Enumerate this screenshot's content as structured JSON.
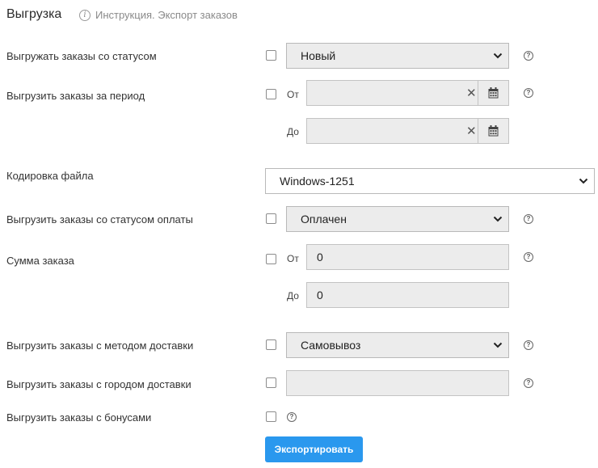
{
  "header": {
    "title": "Выгрузка",
    "help_link": "Инструкция. Экспорт заказов"
  },
  "labels": {
    "from": "От",
    "to": "До"
  },
  "rows": {
    "status": {
      "label": "Выгружать заказы со статусом",
      "selected": "Новый"
    },
    "period": {
      "label": "Выгрузить заказы за период",
      "from_value": "",
      "to_value": ""
    },
    "encoding": {
      "label": "Кодировка файла",
      "selected": "Windows-1251"
    },
    "payment_status": {
      "label": "Выгрузить заказы со статусом оплаты",
      "selected": "Оплачен"
    },
    "amount": {
      "label": "Сумма заказа",
      "from_value": "0",
      "to_value": "0"
    },
    "delivery_method": {
      "label": "Выгрузить заказы с методом доставки",
      "selected": "Самовывоз"
    },
    "delivery_city": {
      "label": "Выгрузить заказы с городом доставки",
      "value": ""
    },
    "bonuses": {
      "label": "Выгрузить заказы с бонусами"
    }
  },
  "actions": {
    "export_label": "Экспортировать"
  },
  "icons": {
    "help": "question-circle-icon",
    "calendar": "calendar-icon",
    "clear": "clear-x-icon",
    "dropdown": "chevron-down-icon",
    "info": "info-circle-icon"
  },
  "colors": {
    "accent": "#2a98ee",
    "field_bg": "#ececec",
    "border": "#b9b9b9"
  }
}
